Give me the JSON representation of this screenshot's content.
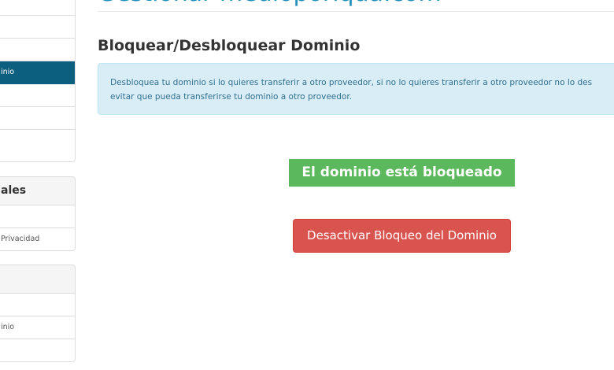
{
  "header": {
    "domain": "Gestionar medioporiqua.com"
  },
  "sidebar": {
    "panel1": {
      "items": [
        {
          "label": ""
        },
        {
          "label": ""
        },
        {
          "label": ""
        },
        {
          "label": "inio"
        },
        {
          "label": ""
        },
        {
          "label": ""
        },
        {
          "label": ""
        }
      ]
    },
    "panel2": {
      "heading": "ales",
      "items": [
        {
          "label": ""
        },
        {
          "label": "Privacidad"
        }
      ]
    },
    "panel3": {
      "heading": "",
      "items": [
        {
          "label": ""
        },
        {
          "label": "inio"
        },
        {
          "label": ""
        }
      ]
    }
  },
  "main": {
    "title": "Bloquear/Desbloquear Dominio",
    "info_line1": "Desbloquea tu dominio si lo quieres transferir a otro proveedor, si no lo quieres transferir a otro proveedor no lo des",
    "info_line2": "evitar que pueda transferirse tu dominio a otro proveedor.",
    "status": "El dominio está bloqueado",
    "unlock_button": "Desactivar Bloqueo del Dominio"
  },
  "colors": {
    "sidebar_active": "#0c5f7e",
    "heading_link": "#1d8fb8",
    "info_background": "#d9edf7",
    "info_text": "#31708f",
    "status_green": "#5cb85c",
    "button_red": "#d9534f"
  }
}
